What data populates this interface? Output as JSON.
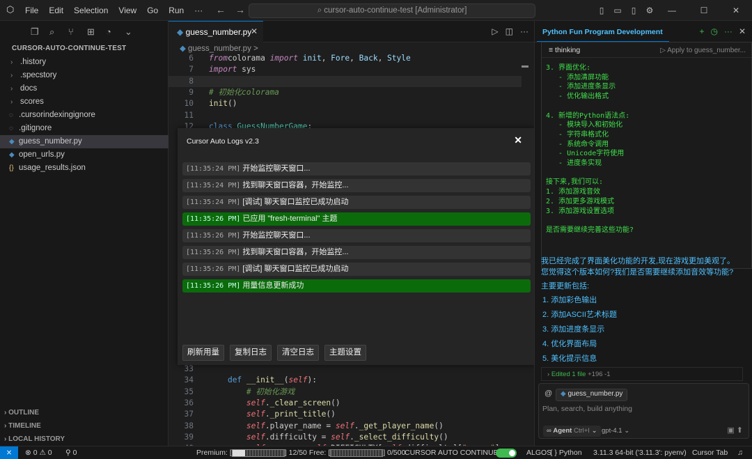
{
  "titlebar": {
    "menu": [
      "File",
      "Edit",
      "Selection",
      "View",
      "Go",
      "Run",
      "···"
    ],
    "search_text": "cursor-auto-continue-test [Administrator]"
  },
  "explorer": {
    "title": "CURSOR-AUTO-CONTINUE-TEST",
    "items": [
      {
        "label": ".history",
        "kind": "folder"
      },
      {
        "label": ".specstory",
        "kind": "folder"
      },
      {
        "label": "docs",
        "kind": "folder"
      },
      {
        "label": "scores",
        "kind": "folder"
      },
      {
        "label": ".cursorindexingignore",
        "kind": "file"
      },
      {
        "label": ".gitignore",
        "kind": "file"
      },
      {
        "label": "guess_number.py",
        "kind": "python",
        "active": true
      },
      {
        "label": "open_urls.py",
        "kind": "python"
      },
      {
        "label": "usage_results.json",
        "kind": "json"
      }
    ],
    "sections": [
      "OUTLINE",
      "TIMELINE",
      "LOCAL HISTORY"
    ]
  },
  "editor": {
    "tab_label": "guess_number.py",
    "breadcrumb": "guess_number.py >",
    "top_lines": [
      {
        "n": "6",
        "tokens": [
          [
            "kw",
            "from"
          ],
          [
            "",
            "colorama "
          ],
          [
            "kw",
            "import"
          ],
          [
            "var",
            " init"
          ],
          [
            "",
            ", "
          ],
          [
            "var",
            "Fore"
          ],
          [
            "",
            ", "
          ],
          [
            "var",
            "Back"
          ],
          [
            "",
            ", "
          ],
          [
            "var",
            "Style"
          ]
        ]
      },
      {
        "n": "7",
        "tokens": [
          [
            "kw",
            "import"
          ],
          [
            "",
            " sys"
          ]
        ]
      },
      {
        "n": "8",
        "tokens": []
      },
      {
        "n": "9",
        "tokens": [
          [
            "cm",
            "# 初始化colorama"
          ]
        ]
      },
      {
        "n": "10",
        "tokens": [
          [
            "fn",
            "init"
          ],
          [
            "",
            "()"
          ]
        ]
      },
      {
        "n": "11",
        "tokens": []
      },
      {
        "n": "12",
        "tokens": [
          [
            "kw2",
            "class"
          ],
          [
            "cls",
            " GuessNumberGame"
          ],
          [
            "",
            ":"
          ]
        ]
      }
    ],
    "bottom_lines": [
      {
        "n": "33",
        "tokens": []
      },
      {
        "n": "34",
        "tokens": [
          [
            "",
            "    "
          ],
          [
            "kw2",
            "def"
          ],
          [
            "fn",
            " __init__"
          ],
          [
            "",
            "("
          ],
          [
            "slf",
            "self"
          ],
          [
            "",
            "):"
          ]
        ]
      },
      {
        "n": "35",
        "tokens": [
          [
            "",
            "        "
          ],
          [
            "cm",
            "# 初始化游戏"
          ]
        ]
      },
      {
        "n": "36",
        "tokens": [
          [
            "",
            "        "
          ],
          [
            "slf",
            "self"
          ],
          [
            "",
            "."
          ],
          [
            "fn",
            "_clear_screen"
          ],
          [
            "",
            "()"
          ]
        ]
      },
      {
        "n": "37",
        "tokens": [
          [
            "",
            "        "
          ],
          [
            "slf",
            "self"
          ],
          [
            "",
            "."
          ],
          [
            "fn",
            "_print_title"
          ],
          [
            "",
            "()"
          ]
        ]
      },
      {
        "n": "38",
        "tokens": [
          [
            "",
            "        "
          ],
          [
            "slf",
            "self"
          ],
          [
            "",
            ".player_name = "
          ],
          [
            "slf",
            "self"
          ],
          [
            "",
            "."
          ],
          [
            "fn",
            "_get_player_name"
          ],
          [
            "",
            "()"
          ]
        ]
      },
      {
        "n": "39",
        "tokens": [
          [
            "",
            "        "
          ],
          [
            "slf",
            "self"
          ],
          [
            "",
            ".difficulty = "
          ],
          [
            "slf",
            "self"
          ],
          [
            "",
            "."
          ],
          [
            "fn",
            "_select_difficulty"
          ],
          [
            "",
            "()"
          ]
        ]
      },
      {
        "n": "40",
        "tokens": [
          [
            "",
            "        "
          ],
          [
            "slf",
            "self"
          ],
          [
            "",
            ".range = "
          ],
          [
            "slf",
            "self"
          ],
          [
            "",
            ".DIFFICULTY["
          ],
          [
            "slf",
            "self"
          ],
          [
            "",
            ".difficulty]["
          ],
          [
            "str",
            "\"range\""
          ],
          [
            "",
            "]"
          ]
        ]
      }
    ]
  },
  "log_panel": {
    "title": "Cursor Auto Logs v2.3",
    "entries": [
      {
        "ts": "[11:35:24 PM]",
        "text": "开始监控聊天窗口...",
        "ok": false
      },
      {
        "ts": "[11:35:24 PM]",
        "text": "找到聊天窗口容器，开始监控...",
        "ok": false
      },
      {
        "ts": "[11:35:24 PM]",
        "text": "[调试] 聊天窗口监控已成功启动",
        "ok": false
      },
      {
        "ts": "[11:35:26 PM]",
        "text": "已应用 \"fresh-terminal\" 主题",
        "ok": true
      },
      {
        "ts": "[11:35:26 PM]",
        "text": "开始监控聊天窗口...",
        "ok": false
      },
      {
        "ts": "[11:35:26 PM]",
        "text": "找到聊天窗口容器，开始监控...",
        "ok": false
      },
      {
        "ts": "[11:35:26 PM]",
        "text": "[调试] 聊天窗口监控已成功启动",
        "ok": false
      },
      {
        "ts": "[11:35:26 PM]",
        "text": "用量信息更新成功",
        "ok": true
      }
    ],
    "buttons": [
      "刷新用量",
      "复制日志",
      "清空日志",
      "主题设置"
    ]
  },
  "chat": {
    "tab_title": "Python Fun Program Development",
    "thinking_label": "thinking",
    "apply_label": "Apply to guess_number...",
    "thinking_lines": [
      "3. 界面优化:",
      "   - 添加清屏功能",
      "   - 添加进度条显示",
      "   - 优化输出格式",
      "",
      "4. 新增的Python语法点:",
      "   - 模块导入和初始化",
      "   - 字符串格式化",
      "   - 系统命令调用",
      "   - Unicode字符使用",
      "   - 进度条实现",
      "",
      "接下来,我们可以:",
      "1. 添加游戏音效",
      "2. 添加更多游戏模式",
      "3. 添加游戏设置选项",
      "",
      "是否需要继续完善这些功能?"
    ],
    "message_lines": [
      "我已经完成了界面美化功能的开发,现在游戏更加美观了。",
      "您觉得这个版本如何?我们是否需要继续添加音效等功能?",
      "主要更新包括:",
      "1. 添加彩色输出",
      "2. 添加ASCII艺术标题",
      "3. 添加进度条显示",
      "4. 优化界面布局",
      "5. 美化提示信息"
    ],
    "edited_label": "Edited 1 file",
    "edited_count": "+196 -1",
    "file_chip": "guess_number.py",
    "input_placeholder": "Plan, search, build anything",
    "agent_label": "Agent",
    "agent_shortcut": "Ctrl+I",
    "model": "gpt-4.1"
  },
  "statusbar": {
    "problems": "⊗ 0 ⚠ 0",
    "ports": "0",
    "premium_label": "Premium:",
    "premium_value": "12/50",
    "premium_fraction": 0.24,
    "free_label": "Free:",
    "free_value": "0/500",
    "free_fraction": 0.0,
    "auto_continue": "CURSOR AUTO CONTINUE",
    "algos": "ALGOS",
    "language": "Python",
    "interpreter": "3.11.3 64-bit ('3.11.3': pyenv)",
    "cursor_tab": "Cursor Tab"
  }
}
